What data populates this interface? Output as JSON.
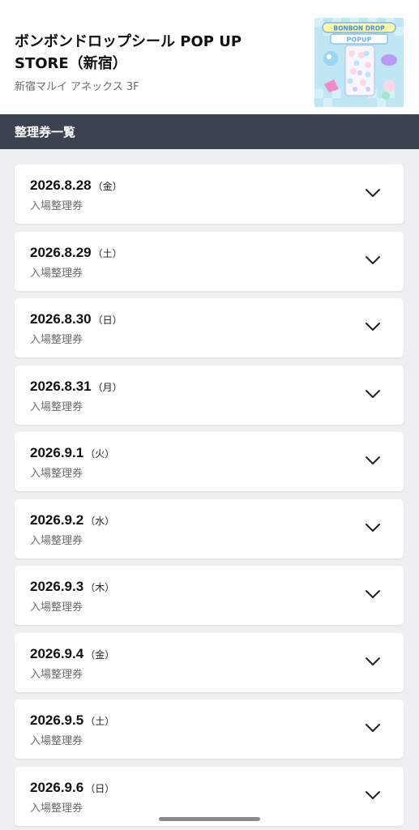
{
  "header": {
    "title": "ボンボンドロップシール POP UP STORE（新宿）",
    "venue": "新宿マルイ アネックス 3F",
    "thumbnail_text": "BONBON DROP",
    "thumbnail_subtext": "POPUP"
  },
  "section": {
    "title": "整理券一覧"
  },
  "dates": [
    {
      "date": "2026.8.28",
      "dow": "（金）",
      "type": "入場整理券"
    },
    {
      "date": "2026.8.29",
      "dow": "（土）",
      "type": "入場整理券"
    },
    {
      "date": "2026.8.30",
      "dow": "（日）",
      "type": "入場整理券"
    },
    {
      "date": "2026.8.31",
      "dow": "（月）",
      "type": "入場整理券"
    },
    {
      "date": "2026.9.1",
      "dow": "（火）",
      "type": "入場整理券"
    },
    {
      "date": "2026.9.2",
      "dow": "（水）",
      "type": "入場整理券"
    },
    {
      "date": "2026.9.3",
      "dow": "（木）",
      "type": "入場整理券"
    },
    {
      "date": "2026.9.4",
      "dow": "（金）",
      "type": "入場整理券"
    },
    {
      "date": "2026.9.5",
      "dow": "（土）",
      "type": "入場整理券"
    },
    {
      "date": "2026.9.6",
      "dow": "（日）",
      "type": "入場整理券"
    }
  ],
  "icons": {
    "expand": "chevron-down-icon"
  },
  "colors": {
    "section_bar": "#3b4250",
    "page_bg": "#eeeff1"
  }
}
